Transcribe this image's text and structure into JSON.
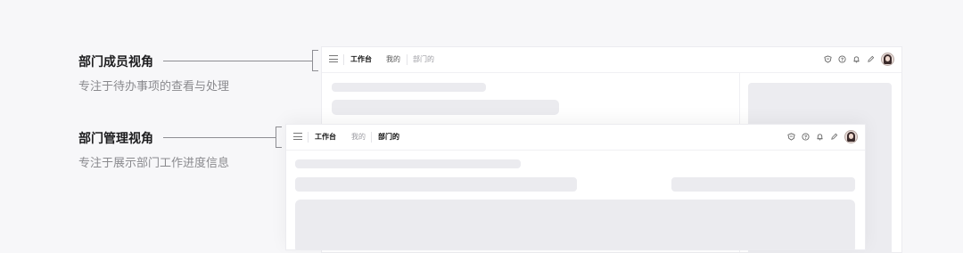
{
  "annotations": [
    {
      "title": "部门成员视角",
      "description": "专注于待办事项的查看与处理"
    },
    {
      "title": "部门管理视角",
      "description": "专注于展示部门工作进度信息"
    }
  ],
  "member_window": {
    "tabs": [
      {
        "label": "工作台",
        "state": "bold"
      },
      {
        "label": "我的",
        "state": "mid"
      },
      {
        "label": "部门的",
        "state": "dim"
      }
    ]
  },
  "manager_window": {
    "tabs": [
      {
        "label": "工作台",
        "state": "bold"
      },
      {
        "label": "我的",
        "state": "dim"
      },
      {
        "label": "部门的",
        "state": "mid"
      }
    ]
  },
  "toolbar_icons": [
    "shield-icon",
    "help-icon",
    "bell-icon",
    "edit-icon",
    "user-avatar"
  ],
  "colors": {
    "background": "#f7f7f9",
    "skeleton": "#ebebef",
    "window": "#ffffff",
    "connector": "#8e8e93"
  }
}
